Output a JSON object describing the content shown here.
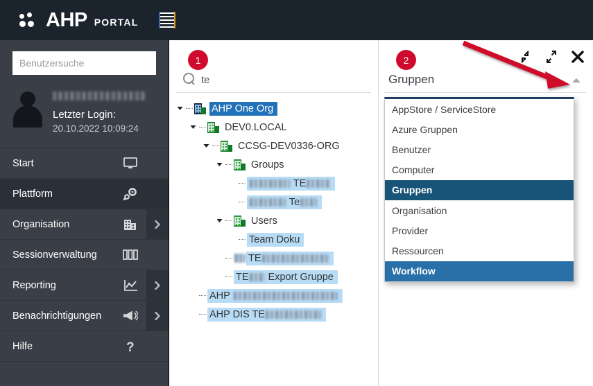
{
  "topbar": {
    "logo_text": "AHP",
    "logo_sub": "PORTAL",
    "logo_icon": "four-dots-logo",
    "menu_icon": "hamburger-menu-icon"
  },
  "sidebar": {
    "search_placeholder": "Benutzersuche",
    "search_value": "",
    "user": {
      "name_redacted": "██████, ████████",
      "last_login_label": "Letzter Login:",
      "last_login_value": "20.10.2022 10:09:24"
    },
    "items": [
      {
        "label": "Start",
        "icon": "monitor-icon",
        "has_chevron": false,
        "active": false
      },
      {
        "label": "Plattform",
        "icon": "gear-icon",
        "has_chevron": false,
        "active": true
      },
      {
        "label": "Organisation",
        "icon": "building-icon",
        "has_chevron": true,
        "active": false
      },
      {
        "label": "Sessionverwaltung",
        "icon": "columns-icon",
        "has_chevron": false,
        "active": false
      },
      {
        "label": "Reporting",
        "icon": "chart-icon",
        "has_chevron": true,
        "active": false
      },
      {
        "label": "Benachrichtigungen",
        "icon": "megaphone-icon",
        "has_chevron": true,
        "active": false
      },
      {
        "label": "Hilfe",
        "icon": "question-mark-icon",
        "has_chevron": false,
        "active": false
      }
    ]
  },
  "tree_panel": {
    "badge": "1",
    "search_icon": "magnifier-icon",
    "search_value": "te",
    "nodes": [
      {
        "label": "AHP One Org",
        "indent": 0,
        "toggle": "open",
        "icon": "org-building-icon-dark",
        "state": "selected"
      },
      {
        "label": "DEV0.LOCAL",
        "indent": 1,
        "toggle": "open",
        "icon": "org-building-icon",
        "state": "plain"
      },
      {
        "label": "CCSG-DEV0336-ORG",
        "indent": 2,
        "toggle": "open",
        "icon": "org-building-icon",
        "state": "plain"
      },
      {
        "label": "Groups",
        "indent": 3,
        "toggle": "open",
        "icon": "org-building-icon",
        "state": "plain"
      },
      {
        "label": "",
        "indent": 4,
        "toggle": "leaf",
        "icon": "none",
        "state": "highlighted",
        "redacted_prefix": 58,
        "mid_text": "TE",
        "redacted_suffix": 34
      },
      {
        "label": "",
        "indent": 4,
        "toggle": "leaf",
        "icon": "none",
        "state": "highlighted",
        "redacted_prefix": 52,
        "mid_text": "Te",
        "redacted_suffix": 24
      },
      {
        "label": "Users",
        "indent": 3,
        "toggle": "open",
        "icon": "org-building-icon",
        "state": "plain"
      },
      {
        "label": "Team Doku",
        "indent": 4,
        "toggle": "leaf",
        "icon": "none",
        "state": "highlighted"
      },
      {
        "label": "",
        "indent": 3,
        "toggle": "leaf",
        "icon": "group-icon-blurred",
        "state": "highlighted",
        "redacted_prefix": 0,
        "mid_text": "TE",
        "redacted_suffix": 96
      },
      {
        "label": "",
        "indent": 3,
        "toggle": "leaf",
        "icon": "none",
        "state": "highlighted",
        "pre_text": "TE",
        "redacted_prefix": 0,
        "mid_text": "",
        "post_text": " Export Gruppe",
        "redacted_suffix": 22
      },
      {
        "label": "",
        "indent": 1,
        "toggle": "leaf",
        "icon": "none",
        "state": "highlighted",
        "pre_text": "AHP ",
        "redacted_suffix": 150
      },
      {
        "label": "",
        "indent": 1,
        "toggle": "leaf",
        "icon": "none",
        "state": "highlighted",
        "pre_text": "AHP DIS TE",
        "redacted_suffix": 80
      }
    ]
  },
  "drop_panel": {
    "badge": "2",
    "title": "Gruppen",
    "caret_icon": "caret-up-icon",
    "window_buttons": [
      {
        "name": "restore-down-icon"
      },
      {
        "name": "maximize-icon"
      },
      {
        "name": "close-icon"
      }
    ],
    "options": [
      {
        "label": "AppStore / ServiceStore",
        "state": "normal"
      },
      {
        "label": "Azure Gruppen",
        "state": "normal"
      },
      {
        "label": "Benutzer",
        "state": "normal"
      },
      {
        "label": "Computer",
        "state": "normal"
      },
      {
        "label": "Gruppen",
        "state": "selected"
      },
      {
        "label": "Organisation",
        "state": "normal"
      },
      {
        "label": "Provider",
        "state": "normal"
      },
      {
        "label": "Ressourcen",
        "state": "normal"
      },
      {
        "label": "Workflow",
        "state": "hover"
      }
    ]
  },
  "annotation": {
    "arrow_color": "#cf0a2c",
    "arrow_name": "red-pointer-arrow"
  },
  "colors": {
    "topbar_bg": "#1b232d",
    "sidebar_bg": "#3a3f47",
    "badge_red": "#cf0a2c",
    "select_blue": "#2272b9",
    "highlight_blue": "#b8dcf5",
    "dropdown_selected": "#185477",
    "dropdown_hover": "#2a70a8"
  }
}
